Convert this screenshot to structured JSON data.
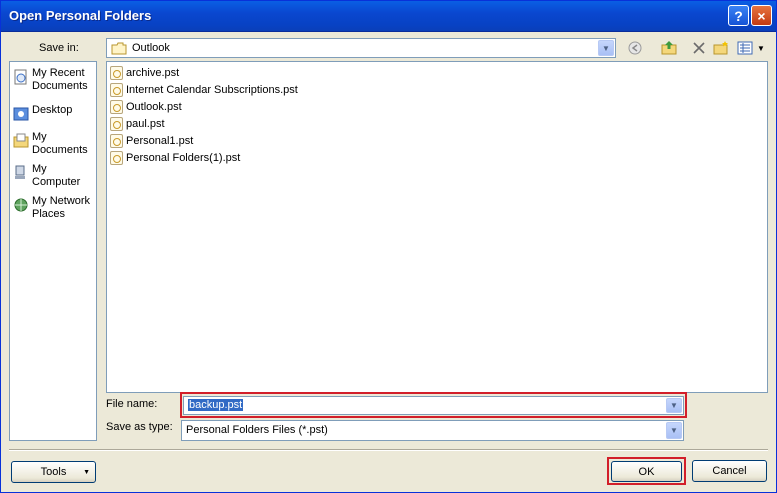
{
  "window": {
    "title": "Open Personal Folders"
  },
  "titlebar": {
    "help_icon": "?",
    "close_icon": "×"
  },
  "save_in": {
    "label": "Save in:",
    "value": "Outlook"
  },
  "toolbar": {
    "icons": [
      "back-icon",
      "up-folder-icon",
      "delete-icon",
      "new-folder-icon",
      "views-icon"
    ]
  },
  "places": [
    {
      "label": "My Recent Documents",
      "icon": "recent-documents-icon"
    },
    {
      "label": "Desktop",
      "icon": "desktop-icon"
    },
    {
      "label": "My Documents",
      "icon": "my-documents-icon"
    },
    {
      "label": "My Computer",
      "icon": "my-computer-icon"
    },
    {
      "label": "My Network Places",
      "icon": "network-places-icon"
    }
  ],
  "files": [
    "archive.pst",
    "Internet Calendar Subscriptions.pst",
    "Outlook.pst",
    "paul.pst",
    "Personal1.pst",
    "Personal Folders(1).pst"
  ],
  "file_name": {
    "label": "File name:",
    "value": "backup.pst"
  },
  "save_as_type": {
    "label": "Save as type:",
    "value": "Personal Folders Files (*.pst)"
  },
  "buttons": {
    "tools": "Tools",
    "ok": "OK",
    "cancel": "Cancel"
  },
  "colors": {
    "title_bar": "#0a47d0",
    "highlight": "#d21f2a",
    "selection": "#316ac5"
  }
}
